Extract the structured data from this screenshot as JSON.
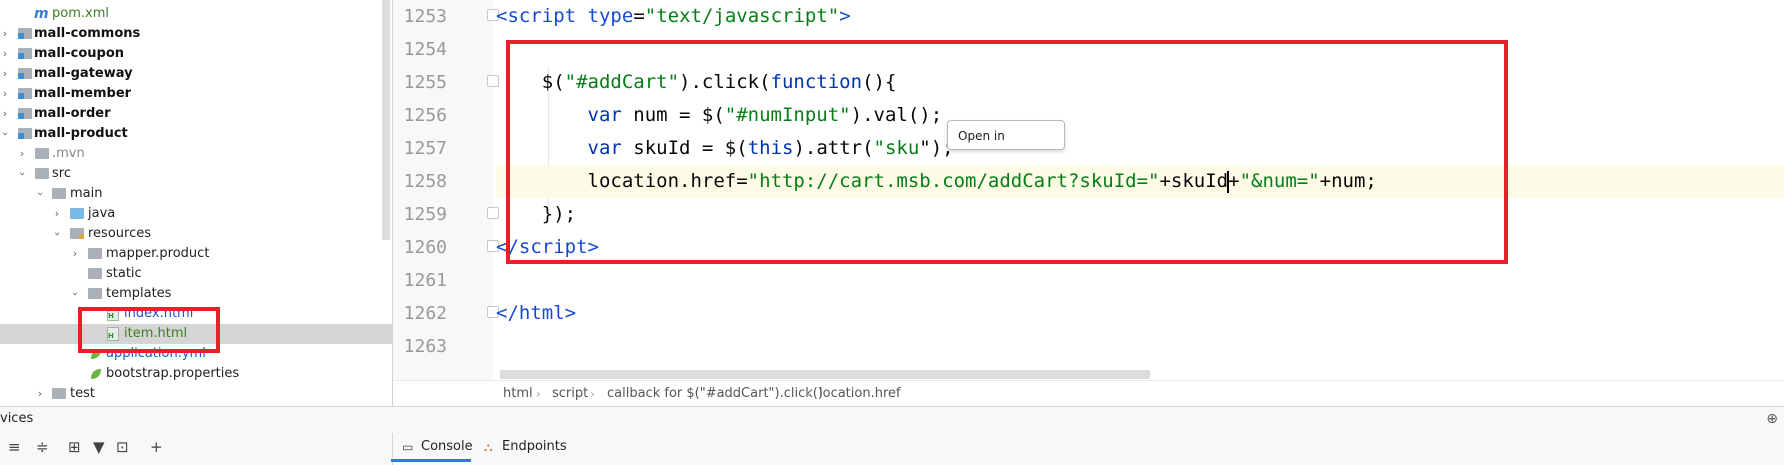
{
  "tree": {
    "items": [
      {
        "label": "pom.xml"
      },
      {
        "label": "mall-commons"
      },
      {
        "label": "mall-coupon"
      },
      {
        "label": "mall-gateway"
      },
      {
        "label": "mall-member"
      },
      {
        "label": "mall-order"
      },
      {
        "label": "mall-product"
      },
      {
        "label": ".mvn"
      },
      {
        "label": "src"
      },
      {
        "label": "main"
      },
      {
        "label": "java"
      },
      {
        "label": "resources"
      },
      {
        "label": "mapper.product"
      },
      {
        "label": "static"
      },
      {
        "label": "templates"
      },
      {
        "label": "index.html"
      },
      {
        "label": "item.html"
      },
      {
        "label": "application.yml"
      },
      {
        "label": "bootstrap.properties"
      },
      {
        "label": "test"
      }
    ],
    "maven_badge": "m",
    "html_badge": "H"
  },
  "editor": {
    "line_numbers": [
      "1253",
      "1254",
      "1255",
      "1256",
      "1257",
      "1258",
      "1259",
      "1260",
      "1261",
      "1262",
      "1263"
    ],
    "lines": [
      {
        "p1": "<",
        "p2": "script",
        "p3": " ",
        "p4": "type",
        "p5": "=",
        "p6": "\"text/javascript\"",
        "p7": ">"
      },
      {},
      {
        "p1": "    $(",
        "p2": "\"#addCart\"",
        "p3": ").click(",
        "p4": "function",
        "p5": "(){"
      },
      {
        "p1": "        ",
        "p2": "var",
        "p3": " num = $(",
        "p4": "\"#numInput\"",
        "p5": ").val();"
      },
      {
        "p1": "        ",
        "p2": "var",
        "p3": " skuId = $(",
        "p4": "this",
        "p5": ").attr(",
        "p6": "\"sku",
        "p7": "\");"
      },
      {
        "p1": "        location.href=",
        "p2": "\"http://cart.msb.com/addCart?skuId=\"",
        "p3": "+skuId",
        "p4": "+",
        "p5": "\"&num=\"",
        "p6": "+num;"
      },
      {
        "p1": "    });"
      },
      {
        "p1": "</",
        "p2": "script",
        "p3": ">"
      },
      {},
      {
        "p1": "</",
        "p2": "html",
        "p3": ">"
      },
      {}
    ],
    "tooltip": "Open in"
  },
  "breadcrumb": {
    "items": [
      "html",
      "script",
      "callback for $(\"#addCart\").click()",
      "location.href"
    ],
    "separator": "›"
  },
  "bottom_panel": {
    "title": "vices",
    "tabs": [
      "Console",
      "Endpoints"
    ]
  },
  "colors": {
    "highlight_box": "#e8202a",
    "string": "#067d17",
    "keyword": "#0033b3",
    "tag": "#174ad4",
    "current_line": "#fdfbe6"
  }
}
